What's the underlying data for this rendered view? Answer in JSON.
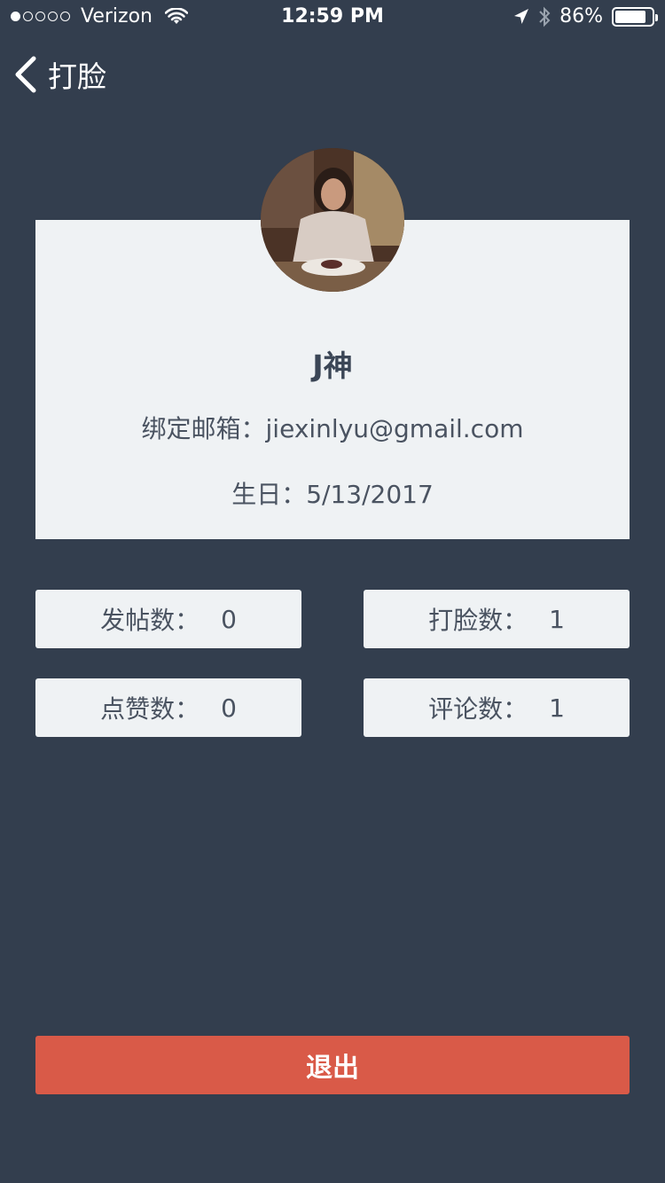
{
  "status_bar": {
    "carrier": "Verizon",
    "time": "12:59 PM",
    "battery_percent": "86%",
    "battery_level": 0.86,
    "signal_bars_filled": 1,
    "signal_bars_total": 5,
    "icons": [
      "wifi-icon",
      "location-arrow-icon",
      "bluetooth-icon",
      "battery-icon"
    ]
  },
  "nav": {
    "title": "打脸",
    "back_icon": "chevron-left-icon"
  },
  "profile": {
    "name": "J神",
    "email_label": "绑定邮箱：",
    "email": "jiexinlyu@gmail.com",
    "birthday_label": "生日：",
    "birthday": "5/13/2017"
  },
  "stats": [
    {
      "label": "发帖数：",
      "value": "0"
    },
    {
      "label": "打脸数：",
      "value": "1"
    },
    {
      "label": "点赞数：",
      "value": "0"
    },
    {
      "label": "评论数：",
      "value": "1"
    }
  ],
  "logout_label": "退出",
  "colors": {
    "background": "#333E4E",
    "card": "#EFF2F4",
    "logout": "#D95A48"
  }
}
